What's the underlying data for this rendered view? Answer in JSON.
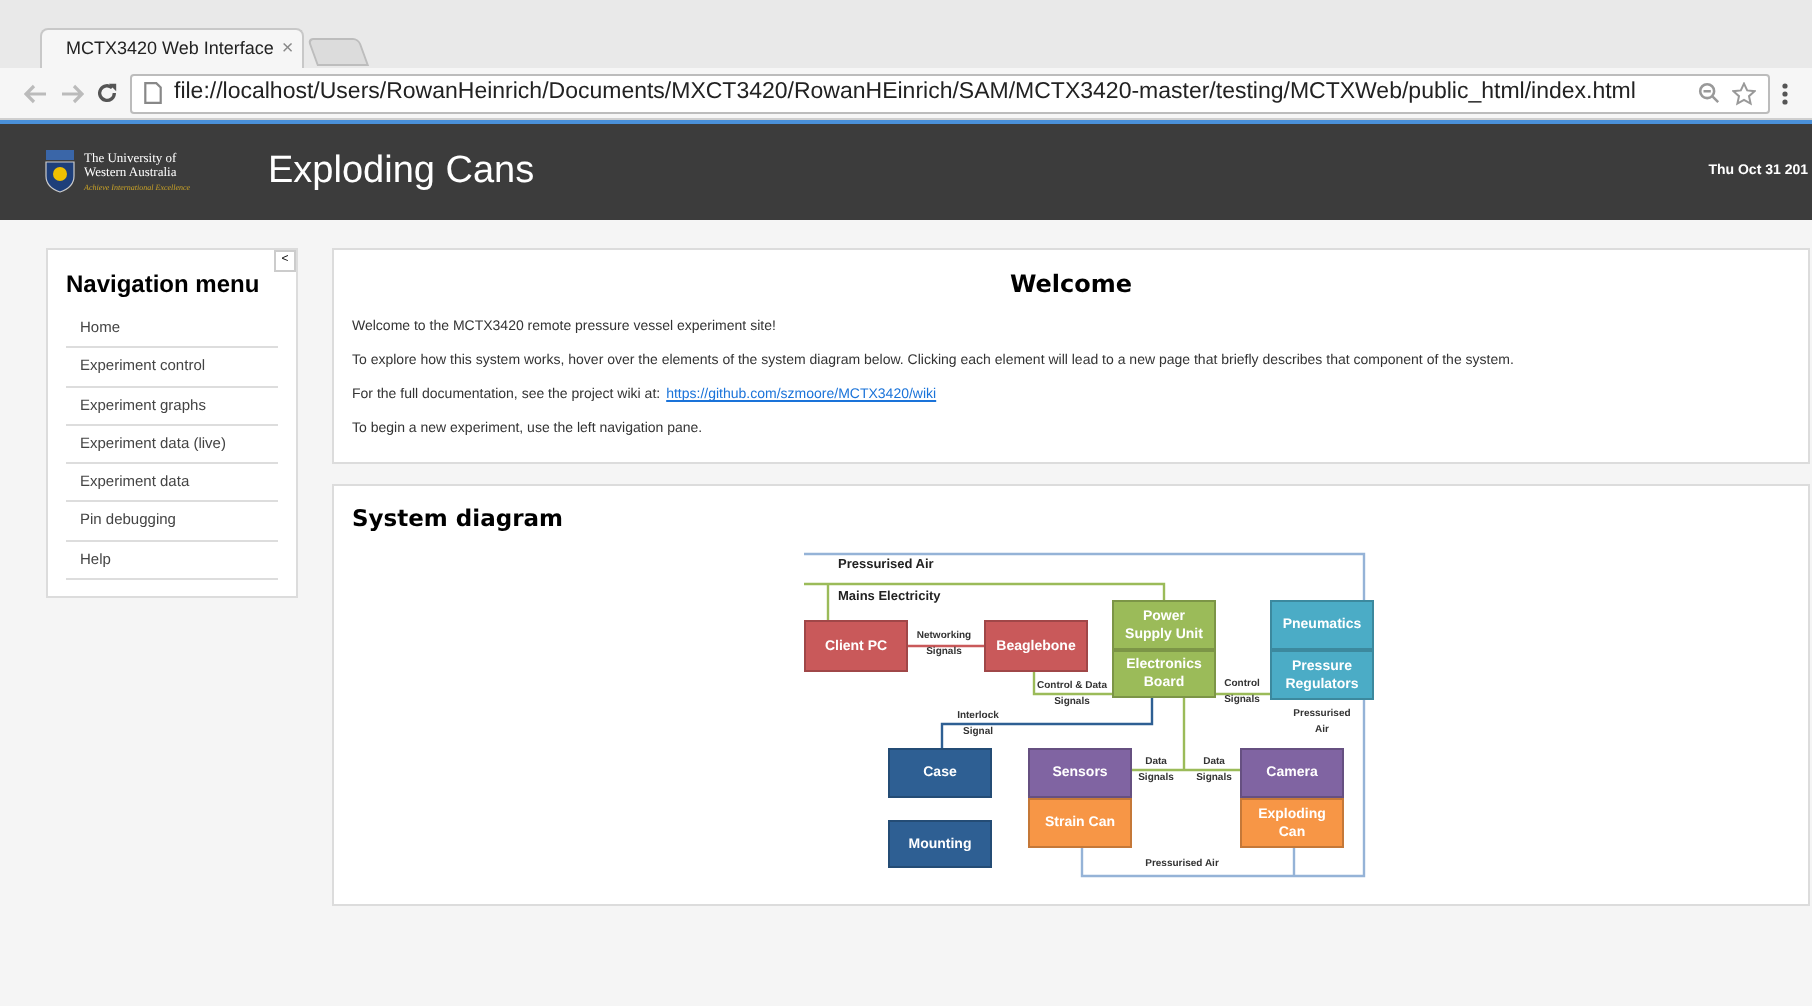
{
  "browser": {
    "tab_title": "MCTX3420 Web Interface",
    "tab_close": "×",
    "url": "file://localhost/Users/RowanHeinrich/Documents/MXCT3420/RowanHEinrich/SAM/MCTX3420-master/testing/MCTXWeb/public_html/index.html"
  },
  "header": {
    "logo_lines": [
      "The University of",
      "Western Australia"
    ],
    "logo_motto": "Achieve International Excellence",
    "title": "Exploding Cans",
    "date": "Thu Oct 31 201"
  },
  "nav": {
    "title": "Navigation menu",
    "collapse": "<",
    "items": [
      {
        "label": "Home"
      },
      {
        "label": "Experiment control"
      },
      {
        "label": "Experiment graphs"
      },
      {
        "label": "Experiment data (live)"
      },
      {
        "label": "Experiment data"
      },
      {
        "label": "Pin debugging"
      },
      {
        "label": "Help"
      }
    ]
  },
  "welcome": {
    "title": "Welcome",
    "paragraphs": [
      {
        "text": "Welcome to the MCTX3420 remote pressure vessel experiment site!"
      },
      {
        "text": "To explore how this system works, hover over the elements of the system diagram below. Clicking each element will lead to a new page that briefly describes that component of the system."
      },
      {
        "text": "For the full documentation, see the project wiki at:",
        "link": "https://github.com/szmoore/MCTX3420/wiki"
      },
      {
        "text": "To begin a new experiment, use the left navigation pane."
      }
    ]
  },
  "diagram": {
    "title": "System diagram",
    "boxes": [
      {
        "label": "Client PC",
        "color": "#c9595a"
      },
      {
        "label": "Beaglebone",
        "color": "#c9595a"
      },
      {
        "label": "Power Supply Unit",
        "color": "#9bbb59"
      },
      {
        "label": "Electronics Board",
        "color": "#9bbb59"
      },
      {
        "label": "Pneumatics",
        "color": "#4bacc6"
      },
      {
        "label": "Pressure Regulators",
        "color": "#4bacc6"
      },
      {
        "label": "Case",
        "color": "#2e5f93"
      },
      {
        "label": "Mounting",
        "color": "#2e5f93"
      },
      {
        "label": "Sensors",
        "color": "#8064a2"
      },
      {
        "label": "Strain Can",
        "color": "#f79646"
      },
      {
        "label": "Camera",
        "color": "#8064a2"
      },
      {
        "label": "Exploding Can",
        "color": "#f79646"
      }
    ],
    "labels": [
      "Pressurised Air",
      "Mains Electricity",
      "Networking Signals",
      "Control & Data Signals",
      "Control Signals",
      "Interlock Signal",
      "Pressurised Air",
      "Data Signals",
      "Data Signals",
      "Pressurised Air"
    ]
  }
}
